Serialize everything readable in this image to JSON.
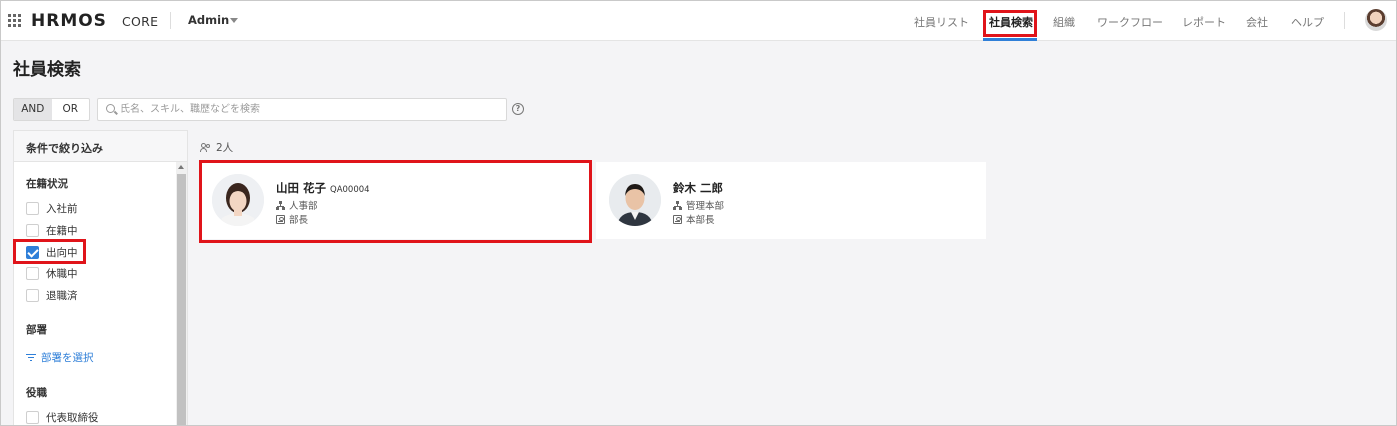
{
  "header": {
    "logo": "HRMOS",
    "logo_sub": "CORE",
    "account": "Admin",
    "nav": [
      {
        "label": "社員リスト",
        "active": false
      },
      {
        "label": "社員検索",
        "active": true
      },
      {
        "label": "組織",
        "active": false
      },
      {
        "label": "ワークフロー",
        "active": false
      },
      {
        "label": "レポート",
        "active": false
      },
      {
        "label": "会社",
        "active": false
      },
      {
        "label": "ヘルプ",
        "active": false
      }
    ]
  },
  "page": {
    "title": "社員検索"
  },
  "search": {
    "and_label": "AND",
    "or_label": "OR",
    "mode": "AND",
    "placeholder": "氏名、スキル、職歴などを検索",
    "value": "",
    "help_glyph": "?"
  },
  "sidebar": {
    "title": "条件で絞り込み",
    "sections": {
      "status": {
        "title": "在籍状況",
        "options": [
          {
            "label": "入社前",
            "checked": false
          },
          {
            "label": "在籍中",
            "checked": false
          },
          {
            "label": "出向中",
            "checked": true
          },
          {
            "label": "休職中",
            "checked": false
          },
          {
            "label": "退職済",
            "checked": false
          }
        ]
      },
      "department": {
        "title": "部署",
        "link_label": "部署を選択"
      },
      "role": {
        "title": "役職",
        "options": [
          {
            "label": "代表取締役",
            "checked": false
          }
        ]
      }
    }
  },
  "results": {
    "count_label": "2人",
    "employees": [
      {
        "name": "山田 花子",
        "code": "QA00004",
        "department": "人事部",
        "position": "部長"
      },
      {
        "name": "鈴木 二郎",
        "code": "",
        "department": "管理本部",
        "position": "本部長"
      }
    ]
  },
  "colors": {
    "accent": "#2f7fd8",
    "highlight": "#e0141a"
  }
}
